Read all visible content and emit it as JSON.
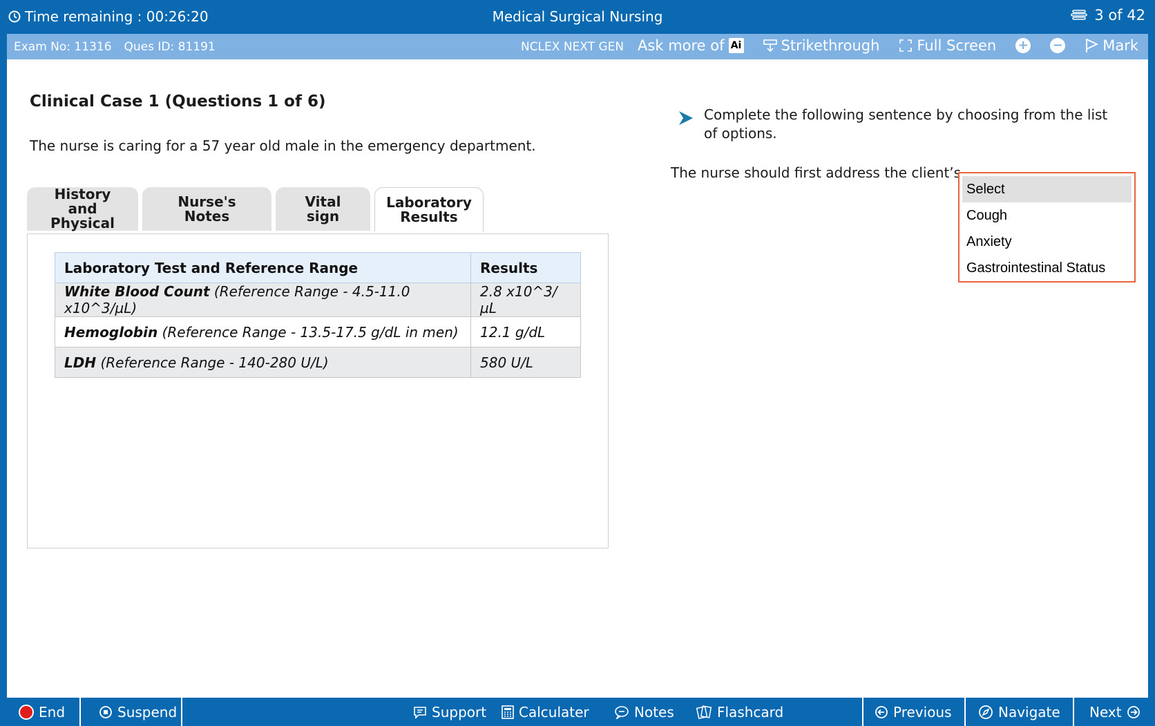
{
  "header": {
    "timer_label": "Time remaining : 00:26:20",
    "title": "Medical Surgical Nursing",
    "question_counter": "3 of 42"
  },
  "subbar": {
    "exam_no": "Exam No: 11316",
    "ques_id": "Ques ID: 81191",
    "exam_type": "NCLEX NEXT GEN",
    "ask_more": "Ask more of",
    "ai_badge": "Ai",
    "strikethrough": "Strikethrough",
    "full_screen": "Full Screen",
    "mark": "Mark"
  },
  "case": {
    "title": "Clinical Case 1 (Questions 1 of 6)",
    "text": "The nurse is caring for a 57 year old male in the emergency department."
  },
  "tabs": [
    {
      "label": "History and Physical",
      "active": false
    },
    {
      "label": "Nurse's Notes",
      "active": false
    },
    {
      "label": "Vital sign",
      "active": false
    },
    {
      "label": "Laboratory Results",
      "active": true
    }
  ],
  "lab_table": {
    "headers": [
      "Laboratory Test and Reference Range",
      "Results"
    ],
    "rows": [
      {
        "test": "White Blood Count",
        "range": " (Reference Range - 4.5-11.0 x10^3/µL)",
        "result": "2.8 x10^3/µL"
      },
      {
        "test": "Hemoglobin",
        "range": " (Reference Range - 13.5-17.5 g/dL in men)",
        "result": "12.1 g/dL"
      },
      {
        "test": "LDH",
        "range": " (Reference Range - 140-280 U/L)",
        "result": "580 U/L"
      }
    ]
  },
  "question": {
    "instruction": "Complete the following sentence by choosing from the list of options.",
    "sentence": "The nurse should first address the client’s",
    "dropdown_options": [
      "Select",
      "Cough",
      "Anxiety",
      "Gastrointestinal Status"
    ],
    "selected_index": 0
  },
  "footer": {
    "end": "End",
    "suspend": "Suspend",
    "support": "Support",
    "calculator": "Calculater",
    "notes": "Notes",
    "flashcard": "Flashcard",
    "previous": "Previous",
    "navigate": "Navigate",
    "next": "Next"
  },
  "colors": {
    "primary_blue": "#0a69b0",
    "toolbar_blue": "#7fb1e3",
    "dropdown_border": "#e8643d",
    "end_red": "#e01d1d"
  }
}
